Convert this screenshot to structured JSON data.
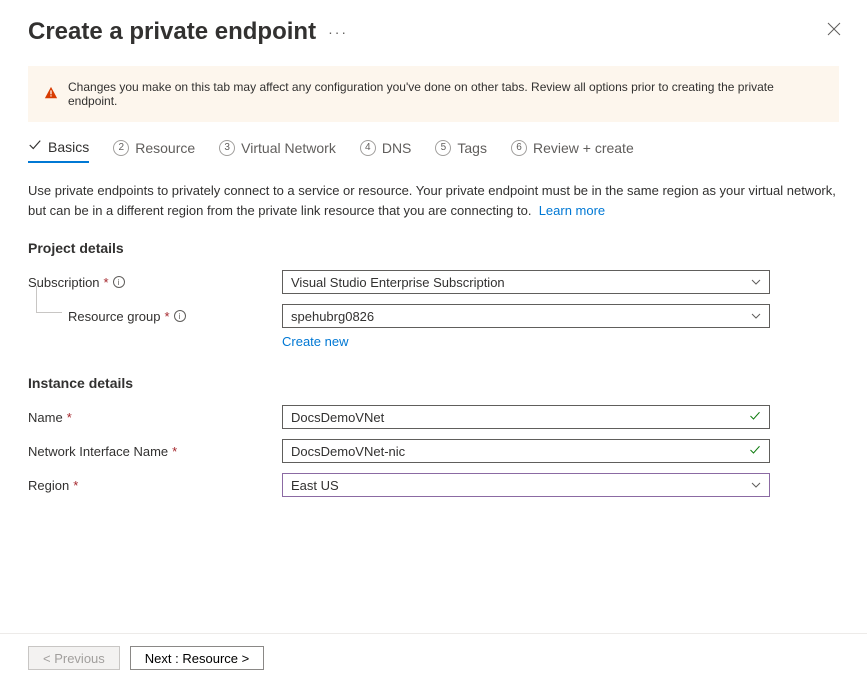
{
  "header": {
    "title": "Create a private endpoint"
  },
  "warning": {
    "text": "Changes you make on this tab may affect any configuration you've done on other tabs. Review all options prior to creating the private endpoint."
  },
  "tabs": {
    "basics": "Basics",
    "resource": "Resource",
    "virtual_network": "Virtual Network",
    "dns": "DNS",
    "tags": "Tags",
    "review": "Review + create"
  },
  "description": {
    "text": "Use private endpoints to privately connect to a service or resource. Your private endpoint must be in the same region as your virtual network, but can be in a different region from the private link resource that you are connecting to.",
    "learn_more": "Learn more"
  },
  "sections": {
    "project_details": "Project details",
    "instance_details": "Instance details"
  },
  "fields": {
    "subscription": {
      "label": "Subscription",
      "value": "Visual Studio Enterprise Subscription"
    },
    "resource_group": {
      "label": "Resource group",
      "value": "spehubrg0826",
      "create_new": "Create new"
    },
    "name": {
      "label": "Name",
      "value": "DocsDemoVNet"
    },
    "nic_name": {
      "label": "Network Interface Name",
      "value": "DocsDemoVNet-nic"
    },
    "region": {
      "label": "Region",
      "value": "East US"
    }
  },
  "footer": {
    "previous": "< Previous",
    "next": "Next : Resource >"
  }
}
